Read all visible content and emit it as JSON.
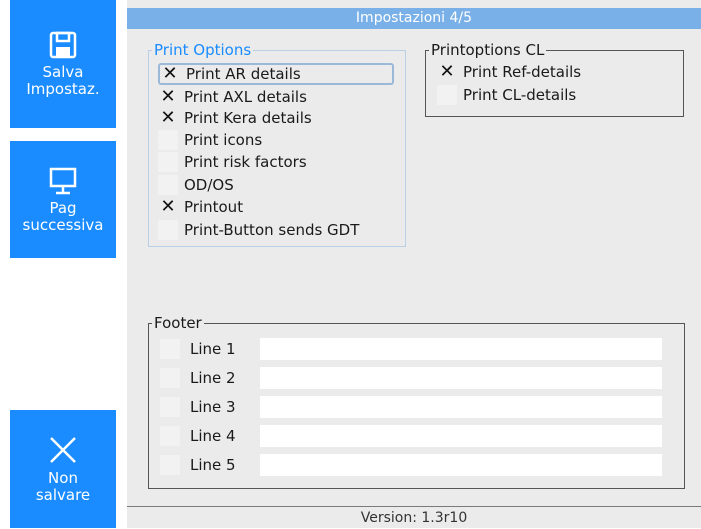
{
  "sidebar": {
    "save": {
      "label_line1": "Salva",
      "label_line2": "Impostaz.",
      "icon": "floppy-disk-icon"
    },
    "next": {
      "label_line1": "Pag",
      "label_line2": "successiva",
      "icon": "monitor-icon"
    },
    "nosave": {
      "label_line1": "Non",
      "label_line2": "salvare",
      "icon": "close-icon"
    }
  },
  "header": {
    "title": "Impostazioni 4/5"
  },
  "print_options": {
    "legend": "Print Options",
    "items": [
      {
        "label": "Print AR details",
        "checked": true,
        "mark": "✕"
      },
      {
        "label": "Print AXL details",
        "checked": true,
        "mark": "✕"
      },
      {
        "label": "Print Kera details",
        "checked": true,
        "mark": "✕"
      },
      {
        "label": "Print icons",
        "checked": false,
        "mark": ""
      },
      {
        "label": "Print risk factors",
        "checked": false,
        "mark": ""
      },
      {
        "label": "OD/OS",
        "checked": false,
        "mark": ""
      },
      {
        "label": "Printout",
        "checked": true,
        "mark": "✕"
      },
      {
        "label": "Print-Button sends GDT",
        "checked": false,
        "mark": ""
      }
    ]
  },
  "printoptions_cl": {
    "legend": "Printoptions CL",
    "items": [
      {
        "label": "Print Ref-details",
        "checked": true,
        "mark": "✕"
      },
      {
        "label": "Print CL-details",
        "checked": false,
        "mark": ""
      }
    ]
  },
  "footer": {
    "legend": "Footer",
    "lines": [
      {
        "label": "Line 1",
        "value": "",
        "checked": false
      },
      {
        "label": "Line 2",
        "value": "",
        "checked": false
      },
      {
        "label": "Line 3",
        "value": "",
        "checked": false
      },
      {
        "label": "Line 4",
        "value": "",
        "checked": false
      },
      {
        "label": "Line 5",
        "value": "",
        "checked": false
      }
    ]
  },
  "status": {
    "version": "Version: 1.3r10"
  },
  "colors": {
    "accent": "#1a8cff",
    "titlebar": "#7ab0e8",
    "panel": "#ebebeb"
  }
}
